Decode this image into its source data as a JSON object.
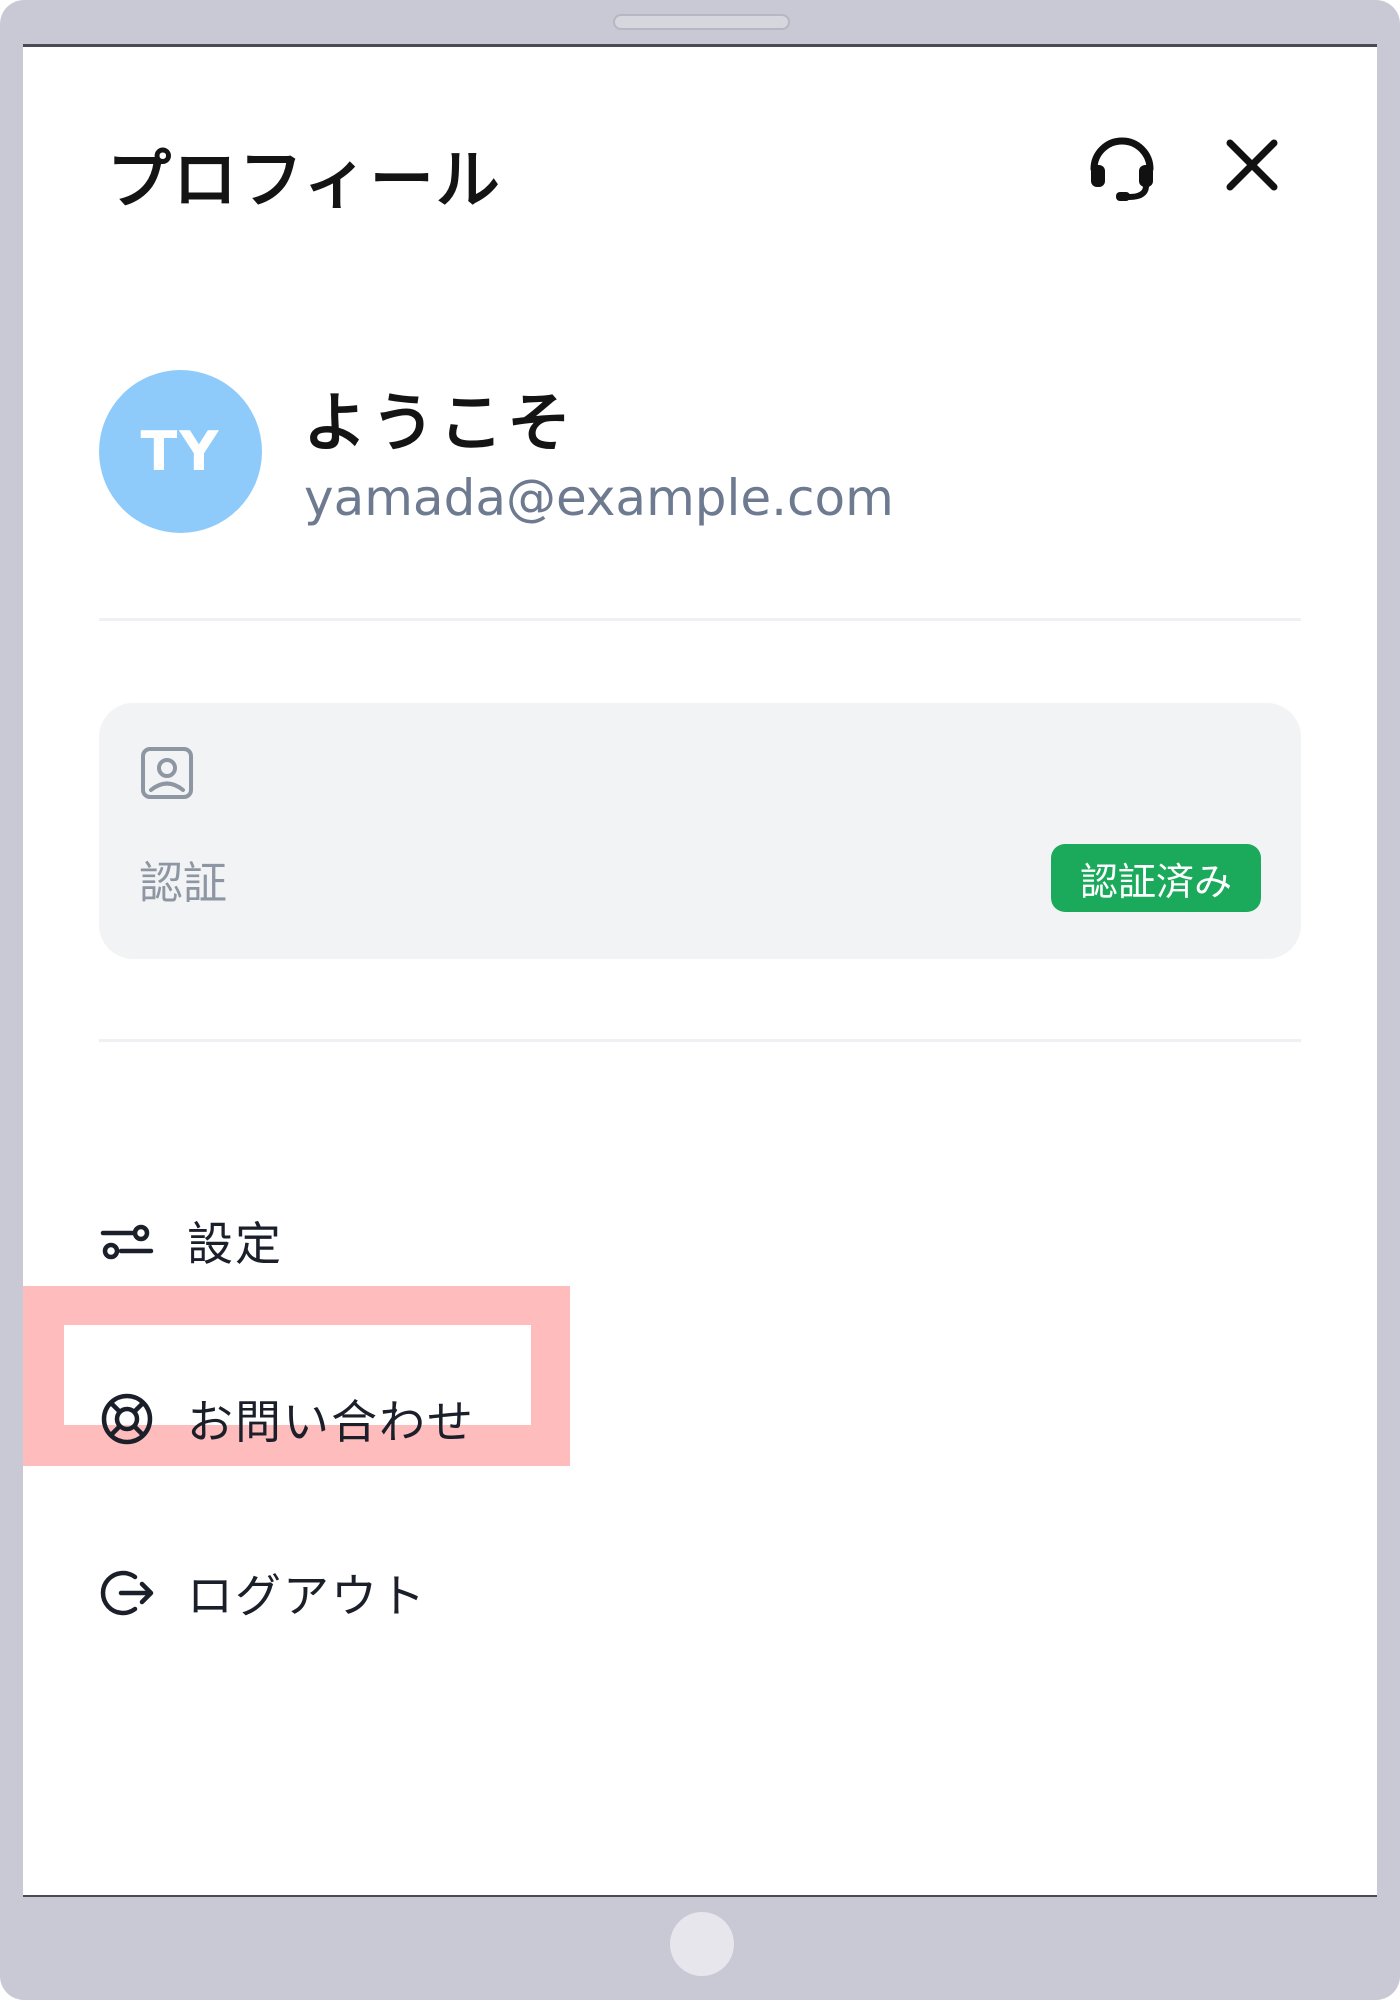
{
  "header": {
    "title": "プロフィール",
    "support_icon": "headset-icon",
    "close_icon": "close-icon"
  },
  "profile": {
    "avatar_initials": "TY",
    "avatar_color": "#8ecbfb",
    "greeting": "ようこそ",
    "email": "yamada@example.com"
  },
  "verification": {
    "icon": "id-card-icon",
    "label": "認証",
    "badge": "認証済み",
    "badge_color": "#1baa5c"
  },
  "menu": {
    "items": [
      {
        "label": "設定",
        "icon": "sliders-icon"
      },
      {
        "label": "お問い合わせ",
        "icon": "lifebuoy-icon",
        "highlighted": true
      },
      {
        "label": "ログアウト",
        "icon": "logout-icon"
      }
    ]
  },
  "colors": {
    "highlight": "#ffbcbc",
    "device_frame": "#c9c9d5"
  }
}
